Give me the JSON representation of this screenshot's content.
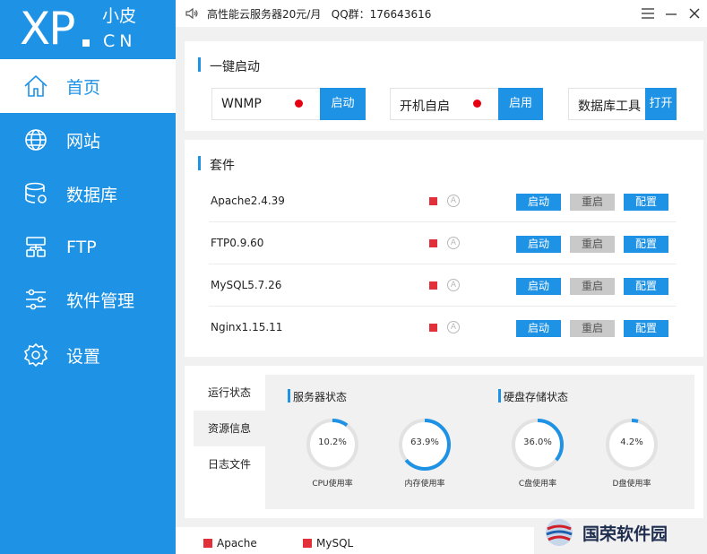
{
  "logo": {
    "xp": "XP",
    "cn_top": "小皮",
    "cn_bottom": "CN"
  },
  "sidebar": {
    "items": [
      {
        "label": "首页",
        "icon": "home-icon",
        "active": true
      },
      {
        "label": "网站",
        "icon": "globe-icon"
      },
      {
        "label": "数据库",
        "icon": "database-icon"
      },
      {
        "label": "FTP",
        "icon": "ftp-icon"
      },
      {
        "label": "软件管理",
        "icon": "sliders-icon"
      },
      {
        "label": "设置",
        "icon": "gear-icon"
      }
    ]
  },
  "topbar": {
    "notice": "高性能云服务器20元/月   QQ群：176643616"
  },
  "quickstart": {
    "title": "一键启动",
    "boxes": [
      {
        "label": "WNMP",
        "button": "启动",
        "status": "stopped"
      },
      {
        "label": "开机自启",
        "button": "启用",
        "status": "stopped"
      },
      {
        "label": "数据库工具",
        "button": "打开"
      }
    ]
  },
  "suites": {
    "title": "套件",
    "rows": [
      {
        "name": "Apache2.4.39",
        "start": "启动",
        "restart": "重启",
        "config": "配置"
      },
      {
        "name": "FTP0.9.60",
        "start": "启动",
        "restart": "重启",
        "config": "配置"
      },
      {
        "name": "MySQL5.7.26",
        "start": "启动",
        "restart": "重启",
        "config": "配置"
      },
      {
        "name": "Nginx1.15.11",
        "start": "启动",
        "restart": "重启",
        "config": "配置"
      }
    ],
    "auto_mark": "A"
  },
  "status": {
    "tabs": [
      "运行状态",
      "资源信息",
      "日志文件"
    ],
    "active_tab": 1,
    "server_title": "服务器状态",
    "disk_title": "硬盘存储状态",
    "gauges": [
      {
        "value": "10.2%",
        "label": "CPU使用率",
        "percent": 10.2
      },
      {
        "value": "63.9%",
        "label": "内存使用率",
        "percent": 63.9
      },
      {
        "value": "36.0%",
        "label": "C盘使用率",
        "percent": 36.0
      },
      {
        "value": "4.2%",
        "label": "D盘使用率",
        "percent": 4.2
      }
    ]
  },
  "footer": {
    "legend": [
      "Apache",
      "MySQL"
    ]
  },
  "watermark": {
    "text": "国荣软件园"
  },
  "colors": {
    "accent": "#1e92e5",
    "stopped": "#e2303a",
    "track": "#e2e2e2"
  }
}
